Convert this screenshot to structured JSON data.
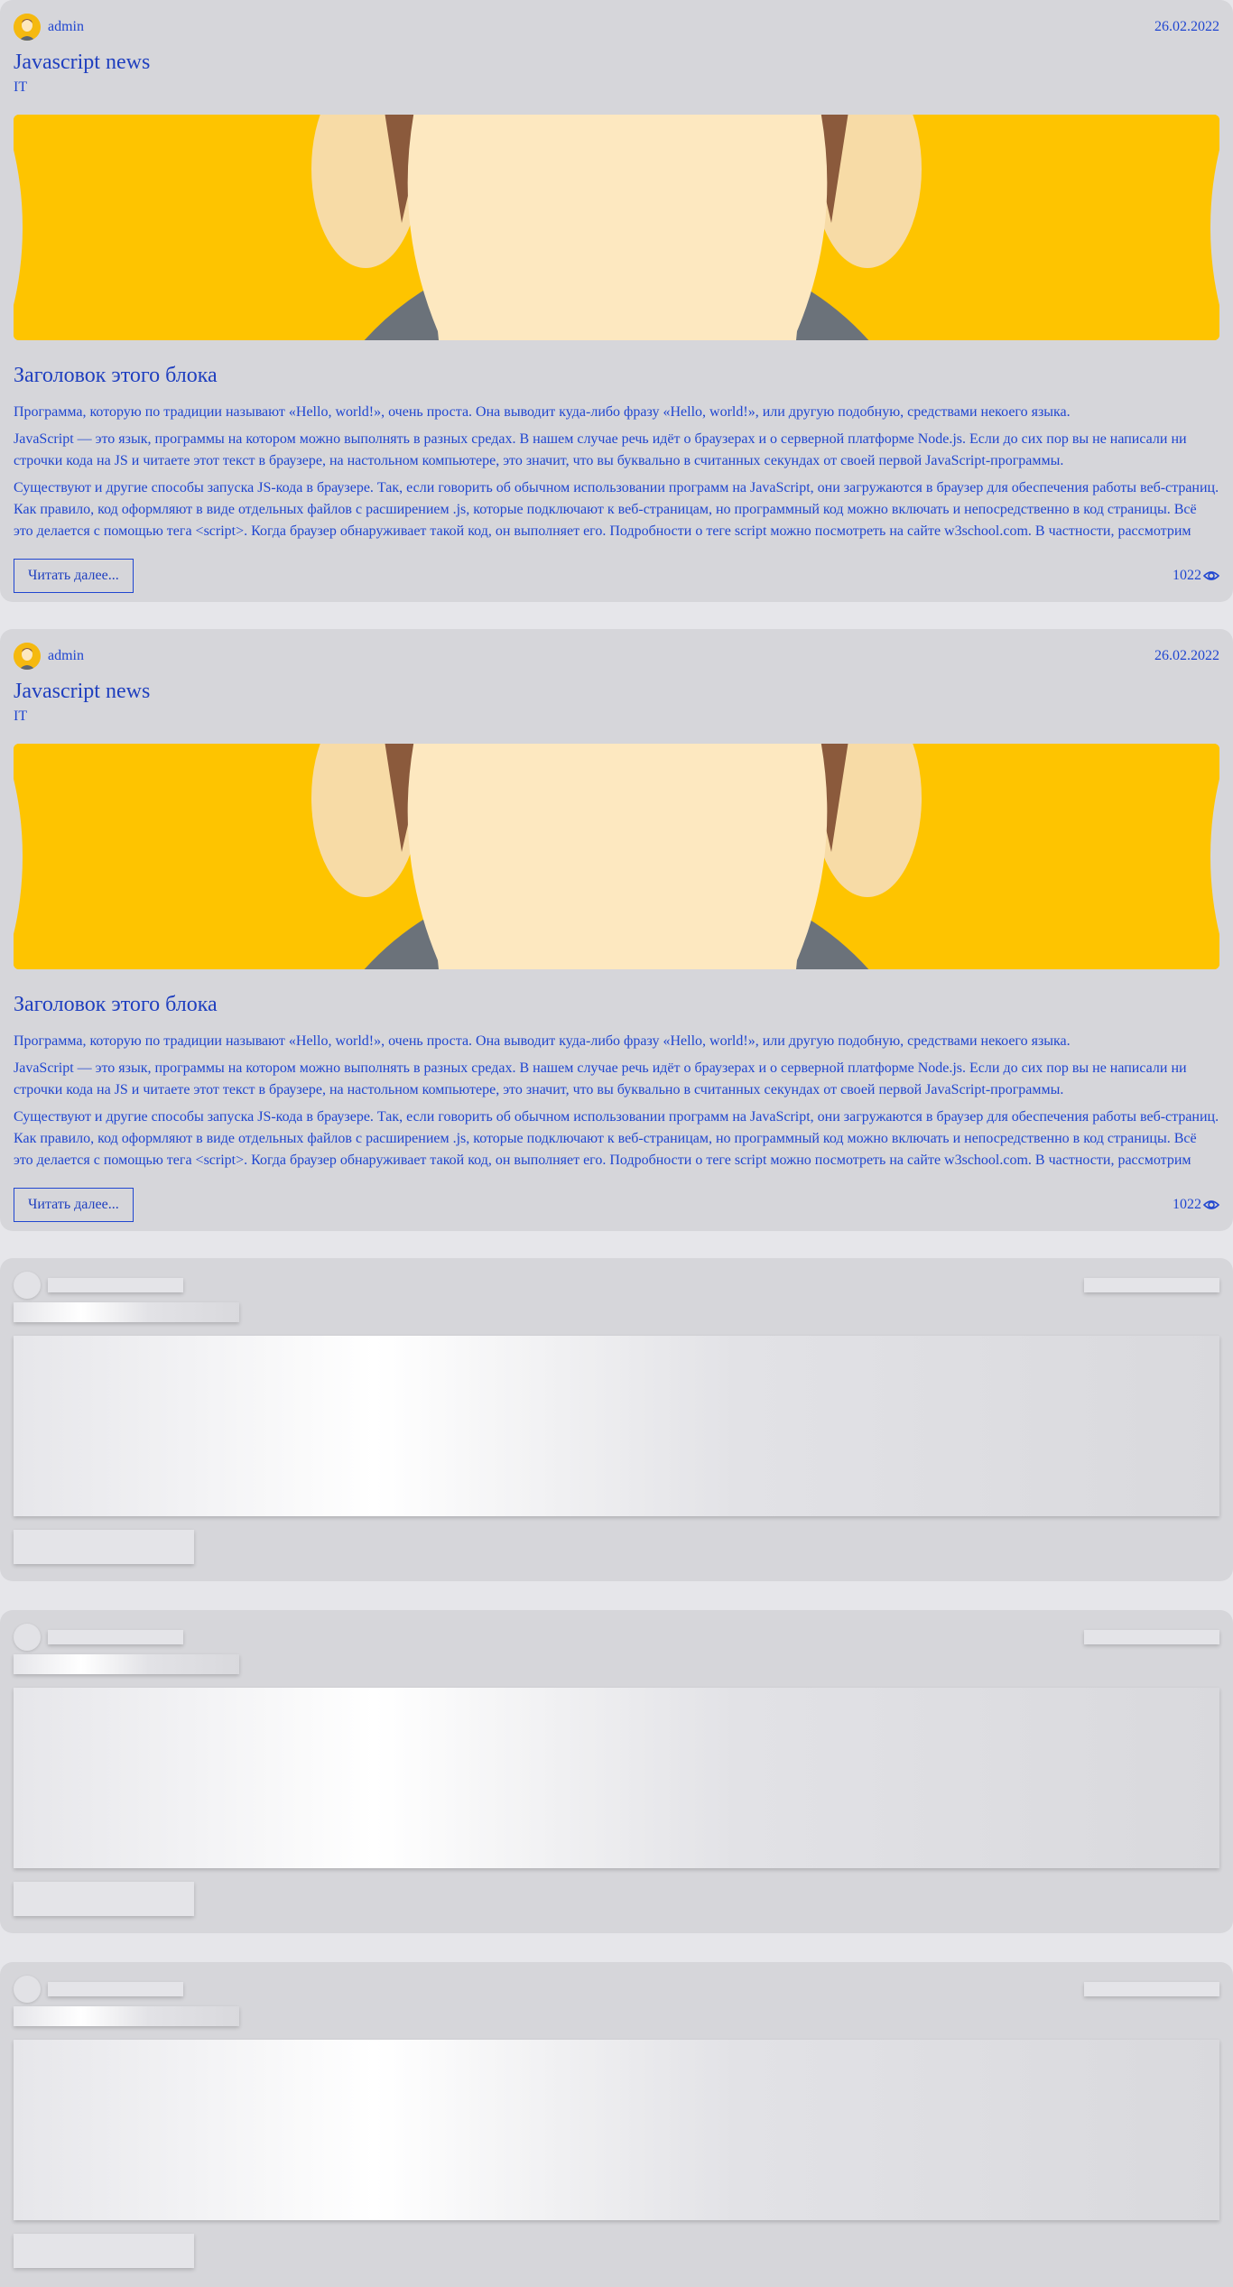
{
  "posts": [
    {
      "author": "admin",
      "date": "26.02.2022",
      "title": "Javascript news",
      "category": "IT",
      "block_title": "Заголовок этого блока",
      "paragraphs": [
        "Программа, которую по традиции называют «Hello, world!», очень проста. Она выводит куда-либо фразу «Hello, world!», или другую подобную, средствами некоего языка.",
        "JavaScript — это язык, программы на котором можно выполнять в разных средах. В нашем случае речь идёт о браузерах и о серверной платформе Node.js. Если до сих пор вы не написали ни строчки кода на JS и читаете этот текст в браузере, на настольном компьютере, это значит, что вы буквально в считанных секундах от своей первой JavaScript-программы.",
        "Существуют и другие способы запуска JS-кода в браузере. Так, если говорить об обычном использовании программ на JavaScript, они загружаются в браузер для обеспечения работы веб-страниц. Как правило, код оформляют в виде отдельных файлов с расширением .js, которые подключают к веб-страницам, но программный код можно включать и непосредственно в код страницы. Всё это делается с помощью тега <script>. Когда браузер обнаруживает такой код, он выполняет его. Подробности о теге script можно посмотреть на сайте w3school.com. В частности, рассмотрим"
      ],
      "read_more": "Читать далее...",
      "views": "1022"
    },
    {
      "author": "admin",
      "date": "26.02.2022",
      "title": "Javascript news",
      "category": "IT",
      "block_title": "Заголовок этого блока",
      "paragraphs": [
        "Программа, которую по традиции называют «Hello, world!», очень проста. Она выводит куда-либо фразу «Hello, world!», или другую подобную, средствами некоего языка.",
        "JavaScript — это язык, программы на котором можно выполнять в разных средах. В нашем случае речь идёт о браузерах и о серверной платформе Node.js. Если до сих пор вы не написали ни строчки кода на JS и читаете этот текст в браузере, на настольном компьютере, это значит, что вы буквально в считанных секундах от своей первой JavaScript-программы.",
        "Существуют и другие способы запуска JS-кода в браузере. Так, если говорить об обычном использовании программ на JavaScript, они загружаются в браузер для обеспечения работы веб-страниц. Как правило, код оформляют в виде отдельных файлов с расширением .js, которые подключают к веб-страницам, но программный код можно включать и непосредственно в код страницы. Всё это делается с помощью тега <script>. Когда браузер обнаруживает такой код, он выполняет его. Подробности о теге script можно посмотреть на сайте w3school.com. В частности, рассмотрим"
      ],
      "read_more": "Читать далее...",
      "views": "1022"
    }
  ],
  "icons": {
    "avatar": "user-avatar-icon",
    "views": "eye-icon"
  },
  "colors": {
    "accent": "#1f3fbf",
    "card_bg": "#d6d6da",
    "page_bg": "#e6e6ea",
    "hero_bg": "#fec400"
  }
}
